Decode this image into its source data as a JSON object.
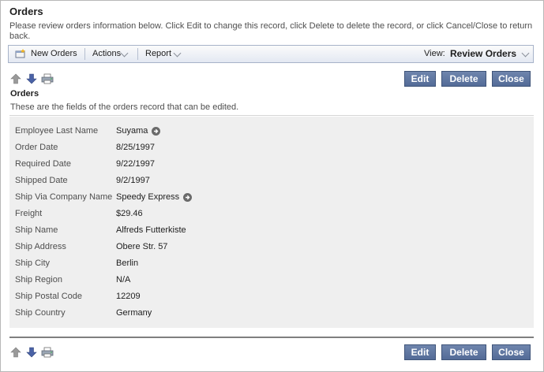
{
  "page": {
    "title": "Orders",
    "description": "Please review orders information below. Click Edit to change this record, click Delete to delete the record, or click Cancel/Close to return back."
  },
  "toolbar": {
    "new_label": "New Orders",
    "actions_label": "Actions",
    "report_label": "Report",
    "view_label": "View:",
    "view_value": "Review Orders"
  },
  "buttons": {
    "edit": "Edit",
    "delete": "Delete",
    "close": "Close"
  },
  "section": {
    "title": "Orders",
    "description": "These are the fields of the orders record that can be edited."
  },
  "fields": [
    {
      "label": "Employee Last Name",
      "value": "Suyama",
      "link": true
    },
    {
      "label": "Order Date",
      "value": "8/25/1997",
      "link": false
    },
    {
      "label": "Required Date",
      "value": "9/22/1997",
      "link": false
    },
    {
      "label": "Shipped Date",
      "value": "9/2/1997",
      "link": false
    },
    {
      "label": "Ship Via Company Name",
      "value": "Speedy Express",
      "link": true
    },
    {
      "label": "Freight",
      "value": "$29.46",
      "link": false
    },
    {
      "label": "Ship Name",
      "value": "Alfreds Futterkiste",
      "link": false
    },
    {
      "label": "Ship Address",
      "value": "Obere Str. 57",
      "link": false
    },
    {
      "label": "Ship City",
      "value": "Berlin",
      "link": false
    },
    {
      "label": "Ship Region",
      "value": "N/A",
      "link": false
    },
    {
      "label": "Ship Postal Code",
      "value": "12209",
      "link": false
    },
    {
      "label": "Ship Country",
      "value": "Germany",
      "link": false
    }
  ],
  "icons": {
    "new": "new-record-icon",
    "actions_chevron": "chevron-down-icon",
    "report_chevron": "chevron-down-icon",
    "view_chevron": "chevron-down-icon",
    "previous": "arrow-up-icon",
    "next": "arrow-down-icon",
    "print": "print-icon",
    "lookup": "arrow-circle-icon"
  },
  "colors": {
    "button_bg": "#5f77a2",
    "toolbar_border": "#a7b3c9",
    "fields_bg": "#efefef"
  }
}
